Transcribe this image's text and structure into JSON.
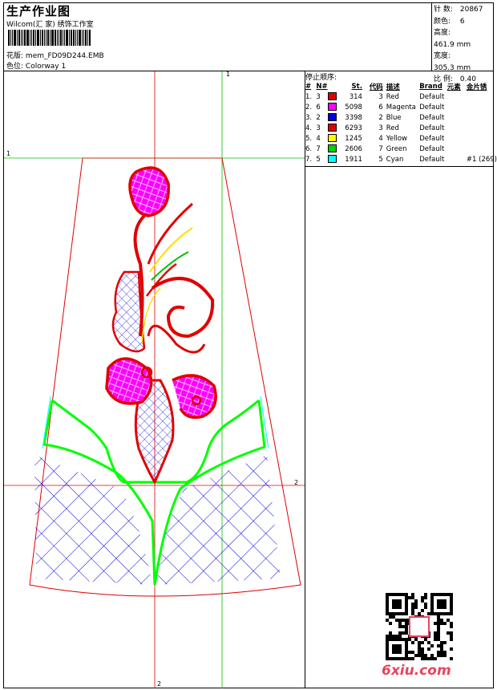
{
  "header": {
    "title": "生产作业图",
    "subtitle": "Wilcom(汇 家) 绣饰工作室",
    "design_label": "花版:",
    "design_value": "mem_FD09D244.EMB",
    "colorway_label": "色位:",
    "colorway_value": "Colorway 1"
  },
  "stats": [
    {
      "label": "针 数:",
      "value": "20867"
    },
    {
      "label": "颜色:",
      "value": "6"
    },
    {
      "label": "高度:",
      "value": "461.9 mm"
    },
    {
      "label": "宽度:",
      "value": "305.3 mm"
    },
    {
      "label": "比 例:",
      "value": "0.40"
    }
  ],
  "sequence": {
    "title": "停止顺序:",
    "headers": [
      "#",
      "N#",
      "St.",
      "代码",
      "描述",
      "Brand",
      "元素",
      "金片锈"
    ],
    "rows": [
      {
        "num": "1.",
        "n": "3",
        "color": "#e00000",
        "st": "314",
        "code": "3",
        "desc": "Red",
        "brand": "Default",
        "elem": "",
        "seq": ""
      },
      {
        "num": "2.",
        "n": "6",
        "color": "#ff00ff",
        "st": "5098",
        "code": "6",
        "desc": "Magenta",
        "brand": "Default",
        "elem": "",
        "seq": ""
      },
      {
        "num": "3.",
        "n": "2",
        "color": "#0000e0",
        "st": "3398",
        "code": "2",
        "desc": "Blue",
        "brand": "Default",
        "elem": "",
        "seq": ""
      },
      {
        "num": "4.",
        "n": "3",
        "color": "#e00000",
        "st": "6293",
        "code": "3",
        "desc": "Red",
        "brand": "Default",
        "elem": "",
        "seq": ""
      },
      {
        "num": "5.",
        "n": "4",
        "color": "#ffff00",
        "st": "1245",
        "code": "4",
        "desc": "Yellow",
        "brand": "Default",
        "elem": "",
        "seq": ""
      },
      {
        "num": "6.",
        "n": "7",
        "color": "#00d000",
        "st": "2606",
        "code": "7",
        "desc": "Green",
        "brand": "Default",
        "elem": "",
        "seq": ""
      },
      {
        "num": "7.",
        "n": "5",
        "color": "#00ffff",
        "st": "1911",
        "code": "5",
        "desc": "Cyan",
        "brand": "Default",
        "elem": "",
        "seq": "#1 (269)"
      }
    ]
  },
  "guides": {
    "top_marker": "1",
    "left_marker": "1",
    "right_marker": "2",
    "bottom_marker": "2"
  },
  "watermark": "6xiu.com"
}
